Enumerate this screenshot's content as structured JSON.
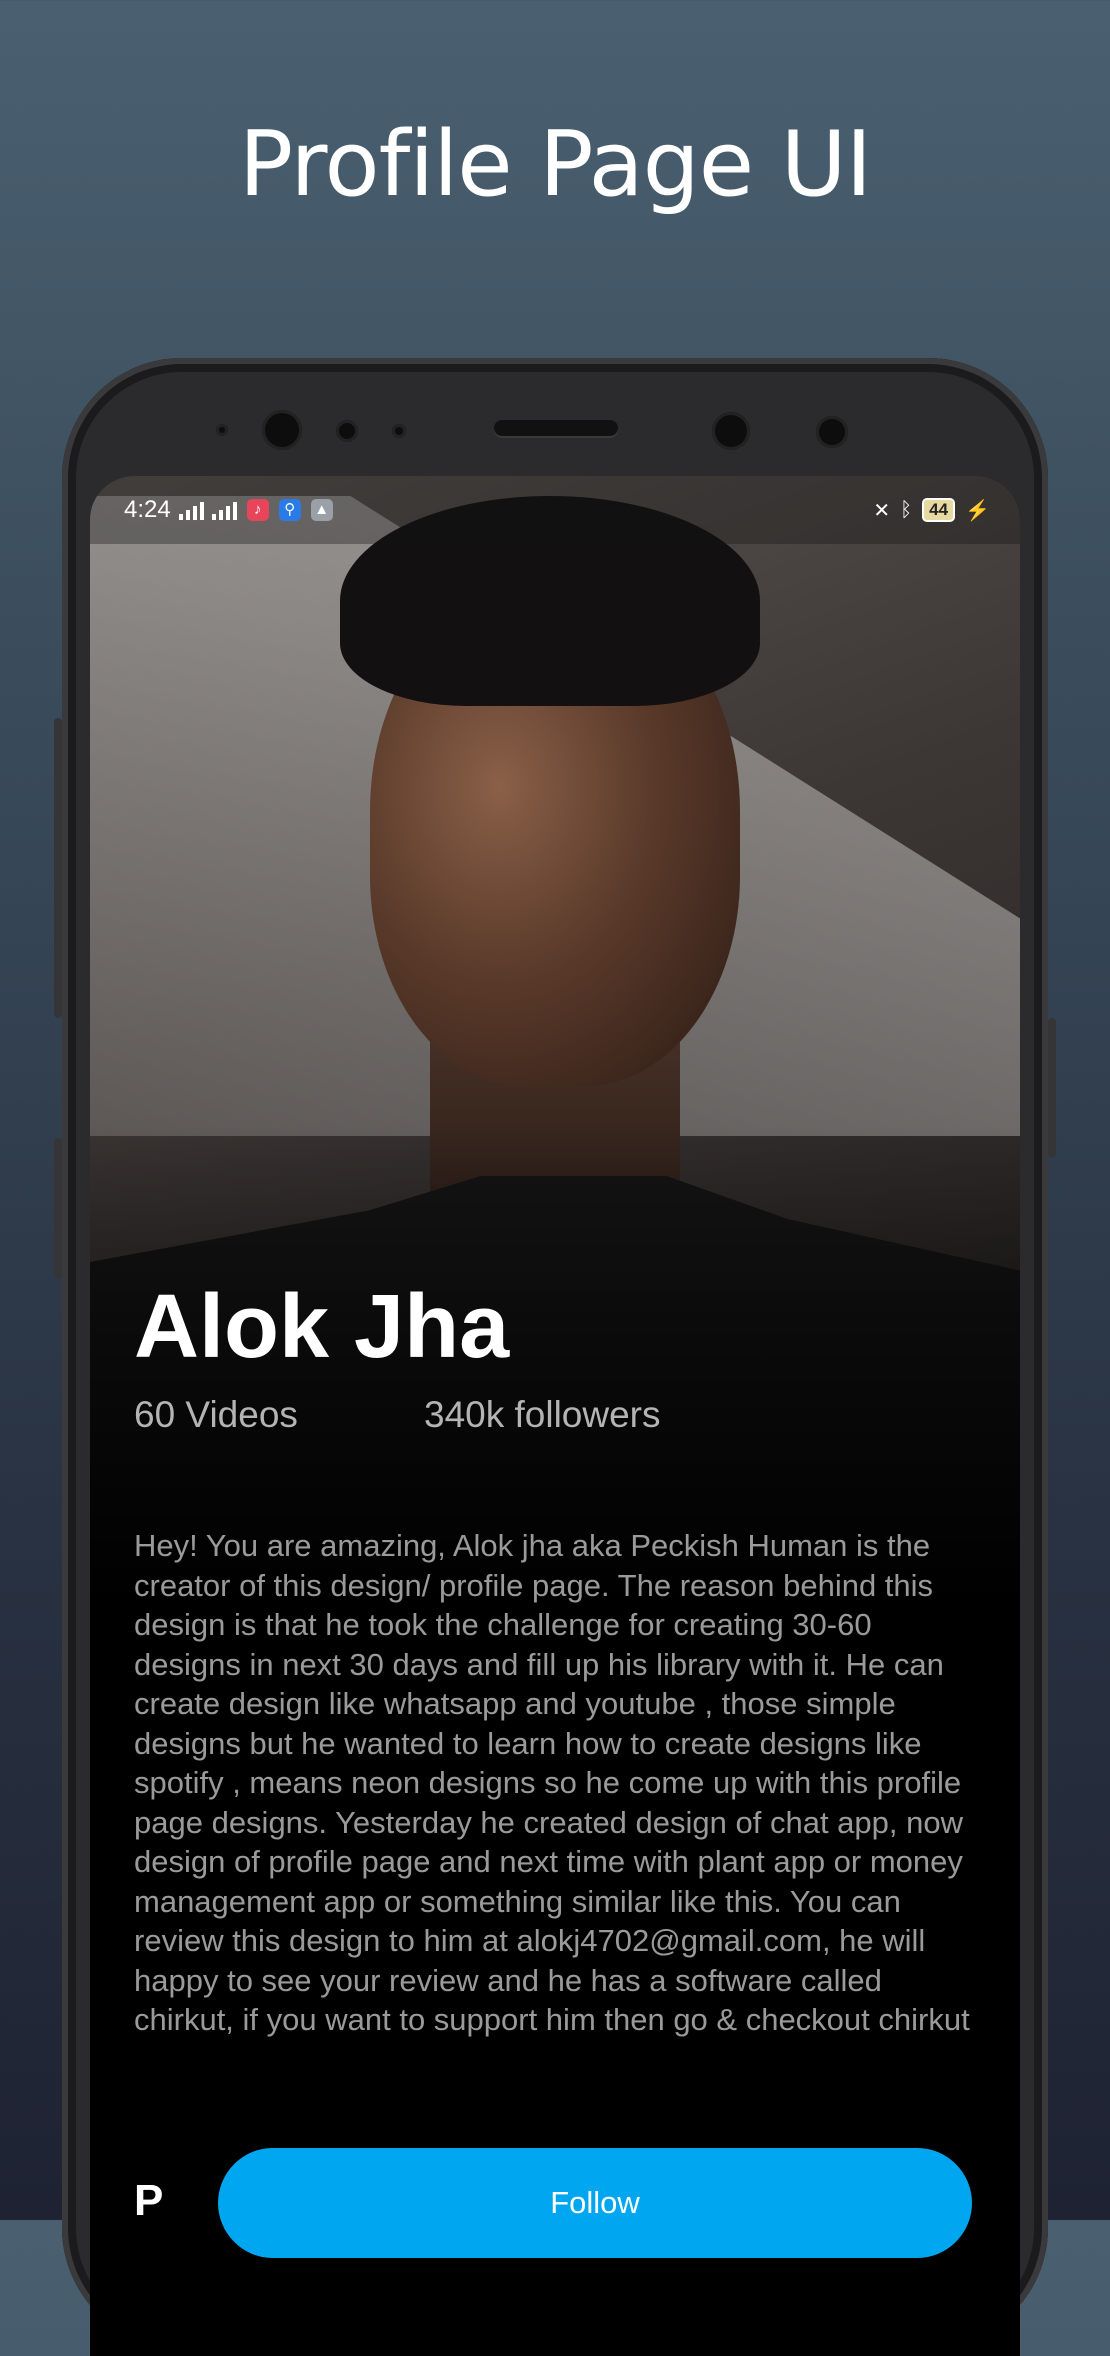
{
  "heading": "Profile Page UI",
  "status_bar": {
    "time": "4:24",
    "battery": "44",
    "app_icons": [
      "music-icon",
      "usb-icon",
      "photos-icon"
    ],
    "right_icons": [
      "vibrate-off-icon",
      "bluetooth-icon",
      "battery-icon",
      "charging-icon"
    ]
  },
  "profile": {
    "name": "Alok Jha",
    "videos": "60 Videos",
    "followers": "340k followers",
    "bio": "Hey! You are amazing, Alok jha aka Peckish Human is the creator of this design/ profile page. The reason behind this design is that he took the challenge for creating 30-60 designs in next 30 days and fill up his library with it. He can create design like whatsapp and youtube , those simple designs but he wanted to learn how to create designs like spotify , means neon designs so he come up with this profile page designs. Yesterday he created design of chat app, now design of profile page and next time with plant app or money management app or something similar like this. You can review this design to him at alokj4702@gmail.com, he will happy to see your review and he has a software called chirkut, if you want to support him then go & checkout chirkut",
    "follow_label": "Follow",
    "partial_heading": "P"
  },
  "colors": {
    "accent": "#00a6f0",
    "background_top": "#4a6070",
    "background_bottom": "#1e2232",
    "screen_bg": "#000000"
  }
}
